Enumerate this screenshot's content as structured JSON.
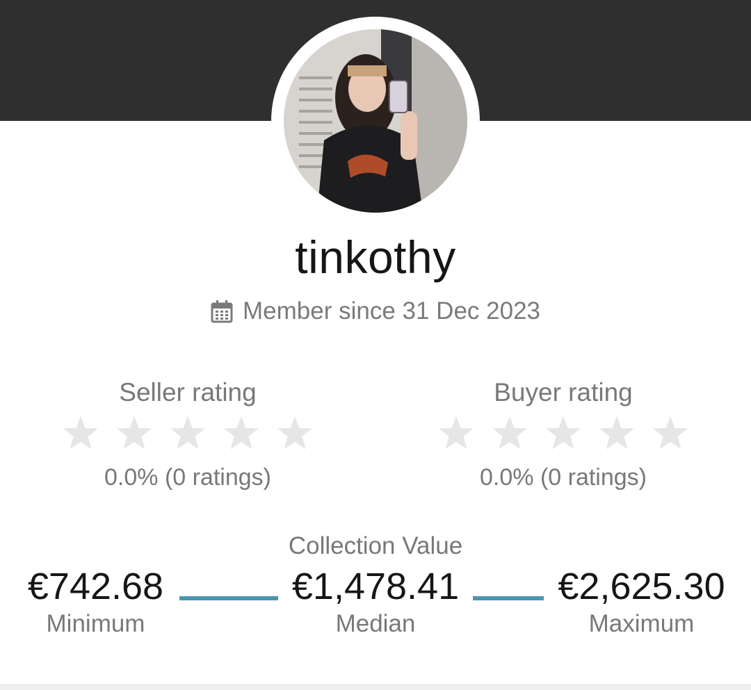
{
  "profile": {
    "username": "tinkothy",
    "member_since": "Member since 31 Dec 2023",
    "avatar_icon": "profile-photo"
  },
  "seller_rating": {
    "title": "Seller rating",
    "stars_filled": 0,
    "stars_total": 5,
    "summary": "0.0% (0 ratings)"
  },
  "buyer_rating": {
    "title": "Buyer rating",
    "stars_filled": 0,
    "stars_total": 5,
    "summary": "0.0% (0 ratings)"
  },
  "collection": {
    "title": "Collection Value",
    "minimum": {
      "value": "€742.68",
      "label": "Minimum"
    },
    "median": {
      "value": "€1,478.41",
      "label": "Median"
    },
    "maximum": {
      "value": "€2,625.30",
      "label": "Maximum"
    }
  },
  "colors": {
    "header": "#2f2f2f",
    "accent_line": "#4a97ad",
    "star_empty": "#e6e6e6"
  }
}
